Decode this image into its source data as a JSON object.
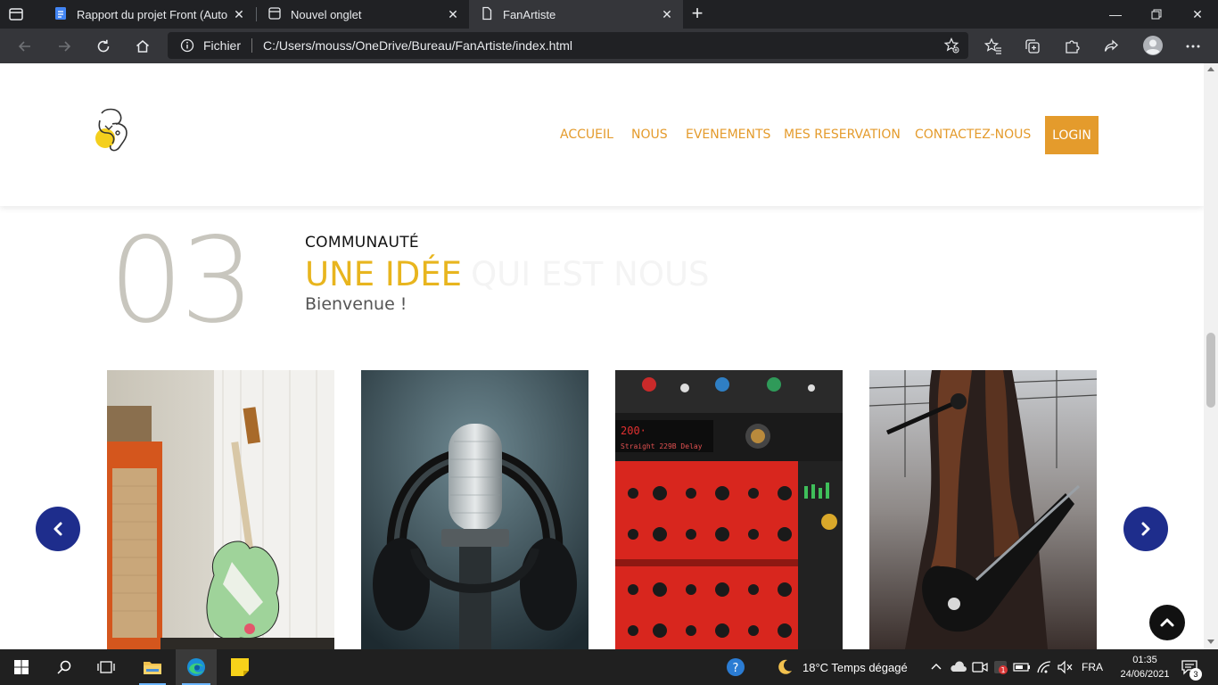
{
  "browser": {
    "tabs": [
      {
        "title": "Rapport du projet Front (AutoRe",
        "icon": "google-docs-icon",
        "active": false
      },
      {
        "title": "Nouvel onglet",
        "icon": "new-tab-page-icon",
        "active": false
      },
      {
        "title": "FanArtiste",
        "icon": "file-icon",
        "active": true
      }
    ],
    "address": {
      "site_label": "Fichier",
      "url": "C:/Users/mouss/OneDrive/Bureau/FanArtiste/index.html"
    }
  },
  "site": {
    "nav": {
      "items": [
        "ACCUEIL",
        "NOUS",
        "EVENEMENTS",
        "MES RESERVATION",
        "CONTACTEZ-NOUS"
      ],
      "login": "LOGIN"
    },
    "section": {
      "number": "03",
      "kicker": "COMMUNAUTÉ",
      "headline": "UNE IDÉE",
      "headline_faded": "QUI EST NOUS",
      "subtitle": "Bienvenue !"
    },
    "carousel": {
      "images": [
        "guitar-amp-photo",
        "studio-microphone-headphones-photo",
        "audio-rack-equipment-photo",
        "woman-playing-guitar-photo"
      ]
    },
    "colors": {
      "accent": "#e49b2c",
      "headline": "#e8b51e",
      "nav_button": "#1e2d8c"
    }
  },
  "taskbar": {
    "weather": "18°C  Temps dégagé",
    "lang": "FRA",
    "time": "01:35",
    "date": "24/06/2021",
    "notifications": "3"
  }
}
